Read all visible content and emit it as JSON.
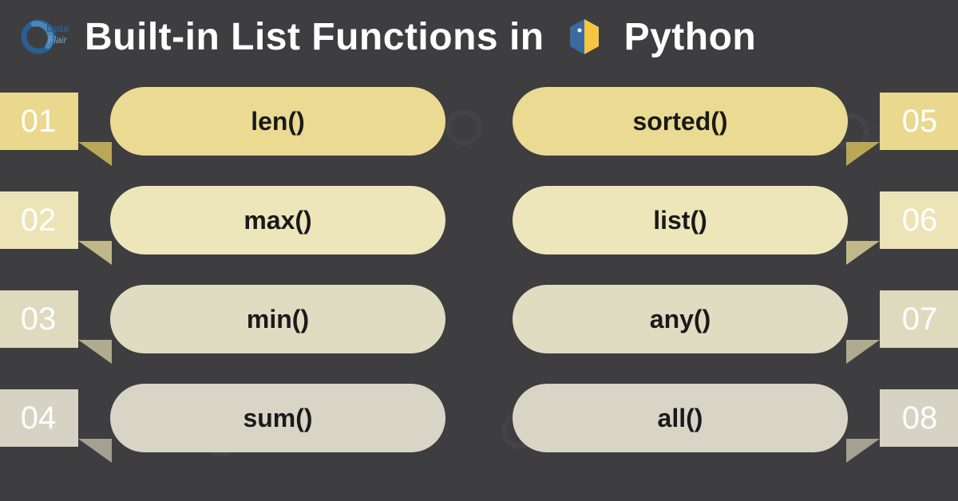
{
  "header": {
    "title_part1": "Built-in List Functions in",
    "title_part2": "Python",
    "brand": "DataFlair"
  },
  "items": {
    "left": [
      {
        "num": "01",
        "label": "len()"
      },
      {
        "num": "02",
        "label": "max()"
      },
      {
        "num": "03",
        "label": "min()"
      },
      {
        "num": "04",
        "label": "sum()"
      }
    ],
    "right": [
      {
        "num": "05",
        "label": "sorted()"
      },
      {
        "num": "06",
        "label": "list()"
      },
      {
        "num": "07",
        "label": "any()"
      },
      {
        "num": "08",
        "label": "all()"
      }
    ]
  },
  "colors": {
    "bg": "#3e3d40",
    "row1": "#ebda92",
    "row2": "#eee6bb",
    "row3": "#e0dcc2",
    "row4": "#d8d5c7"
  }
}
